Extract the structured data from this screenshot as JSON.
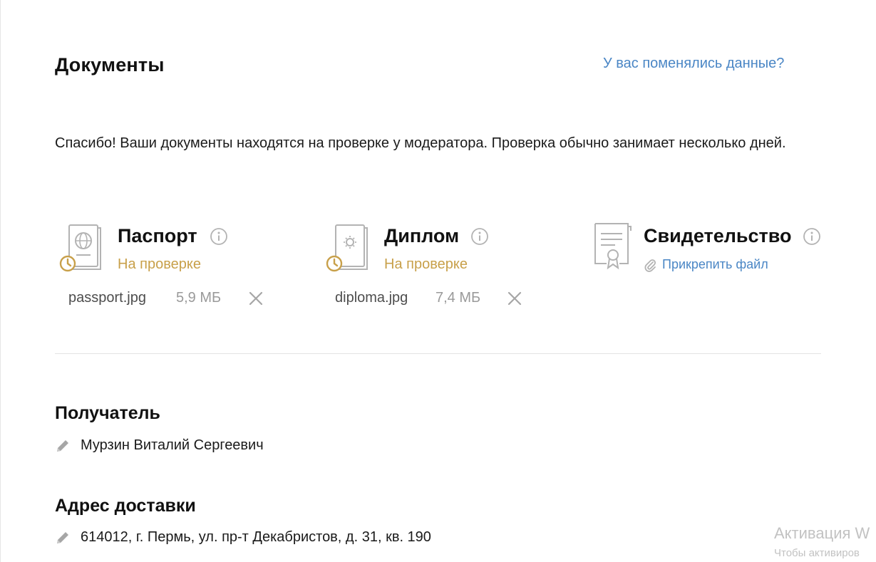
{
  "documents": {
    "title": "Документы",
    "changed_link": "У вас поменялись данные?",
    "notice": "Спасибо! Ваши документы находятся на проверке у модератора. Проверка обычно занимает несколько дней.",
    "items": [
      {
        "title": "Паспорт",
        "status": "На проверке",
        "file_name": "passport.jpg",
        "file_size": "5,9 МБ",
        "icon": "passport-icon"
      },
      {
        "title": "Диплом",
        "status": "На проверке",
        "file_name": "diploma.jpg",
        "file_size": "7,4 МБ",
        "icon": "diploma-icon"
      },
      {
        "title": "Свидетельство",
        "attach_label": "Прикрепить файл",
        "icon": "certificate-icon"
      }
    ]
  },
  "recipient": {
    "title": "Получатель",
    "value": "Мурзин Виталий Сергеевич"
  },
  "delivery": {
    "title": "Адрес доставки",
    "value": "614012, г. Пермь, ул. пр-т Декабристов, д. 31, кв. 190"
  },
  "watermark": {
    "line1": "Активация W",
    "line2": "Чтобы активиров"
  },
  "colors": {
    "link": "#4a86c5",
    "status_pending": "#c8a04a",
    "icon_gray": "#b3b3b3",
    "divider": "#e3e3e3"
  }
}
